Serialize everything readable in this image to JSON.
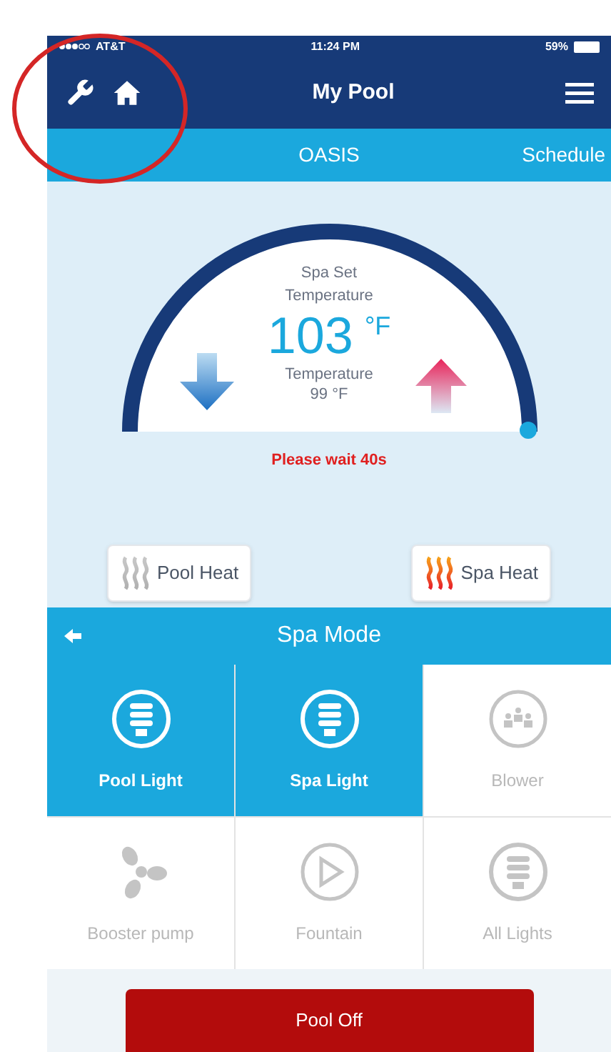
{
  "status_bar": {
    "carrier": "AT&T",
    "time": "11:24 PM",
    "battery": "59%"
  },
  "nav_bar": {
    "title": "My Pool"
  },
  "sub_bar": {
    "title": "OASIS",
    "action": "Schedule"
  },
  "thermostat": {
    "label": "Spa Set Temperature",
    "set_point": "103",
    "unit": "°F",
    "current_label": "Temperature",
    "current_value": "99 °F",
    "message": "Please wait 40s"
  },
  "heaters": [
    {
      "label": "Pool Heat",
      "on": false
    },
    {
      "label": "Spa Heat",
      "on": true
    }
  ],
  "mode_bar": {
    "title": "Spa Mode"
  },
  "features": [
    {
      "label": "Pool Light",
      "kind": "bulb",
      "selected": true
    },
    {
      "label": "Spa Light",
      "kind": "bulb",
      "selected": true
    },
    {
      "label": "Blower",
      "kind": "blower",
      "selected": false
    },
    {
      "label": "Booster pump",
      "kind": "fan",
      "selected": false
    },
    {
      "label": "Fountain",
      "kind": "play",
      "selected": false
    },
    {
      "label": "All Lights",
      "kind": "bulb",
      "selected": false
    }
  ],
  "action_button": {
    "label": "Pool Off"
  }
}
